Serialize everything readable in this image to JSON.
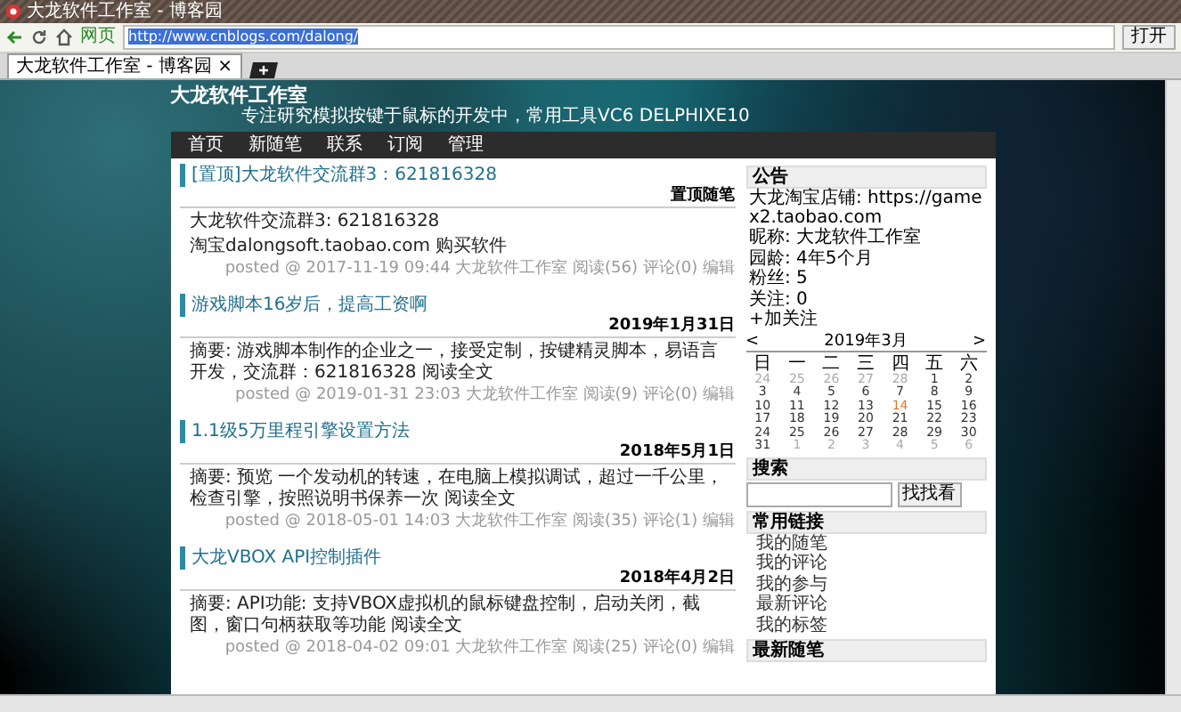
{
  "browser": {
    "window_title": "大龙软件工作室 - 博客园",
    "site_label": "网页",
    "address": "http://www.cnblogs.com/dalong/",
    "go_button": "打开",
    "tab": {
      "title": "大龙软件工作室 - 博客园",
      "close": "×"
    }
  },
  "blog": {
    "title": "大龙软件工作室",
    "subtitle": "专注研究模拟按键于鼠标的开发中，常用工具VC6 DELPHIXE10",
    "nav": [
      "首页",
      "新随笔",
      "联系",
      "订阅",
      "管理"
    ]
  },
  "posts": [
    {
      "title": "[置顶]大龙软件交流群3：621816328",
      "date": "置顶随笔",
      "body": [
        "大龙软件交流群3: 621816328",
        "淘宝dalongsoft.taobao.com 购买软件"
      ],
      "footer": "posted @ 2017-11-19 09:44 大龙软件工作室 阅读(56) 评论(0) 编辑"
    },
    {
      "title": "游戏脚本16岁后，提高工资啊",
      "date": "2019年1月31日",
      "body": [
        "摘要: 游戏脚本制作的企业之一，接受定制，按键精灵脚本，易语言开发，交流群：621816328 阅读全文"
      ],
      "footer": "posted @ 2019-01-31 23:03 大龙软件工作室 阅读(9) 评论(0) 编辑"
    },
    {
      "title": "1.1级5万里程引擎设置方法",
      "date": "2018年5月1日",
      "body": [
        "摘要: 预览 一个发动机的转速，在电脑上模拟调试，超过一千公里，检查引擎，按照说明书保养一次 阅读全文"
      ],
      "footer": "posted @ 2018-05-01 14:03 大龙软件工作室 阅读(35) 评论(1) 编辑"
    },
    {
      "title": "大龙VBOX API控制插件",
      "date": "2018年4月2日",
      "body": [
        "摘要: API功能: 支持VBOX虚拟机的鼠标键盘控制，启动关闭，截图，窗口句柄获取等功能 阅读全文"
      ],
      "footer": "posted @ 2018-04-02 09:01 大龙软件工作室 阅读(25) 评论(0) 编辑"
    }
  ],
  "sidebar": {
    "notice": {
      "heading": "公告",
      "lines": [
        "大龙淘宝店铺: https://gamex2.taobao.com",
        "昵称: 大龙软件工作室",
        "园龄: 4年5个月",
        "粉丝: 5",
        "关注: 0"
      ],
      "follow": "+加关注"
    },
    "calendar": {
      "month": "2019年3月",
      "prev": "<",
      "next": ">",
      "weekdays": [
        "日",
        "一",
        "二",
        "三",
        "四",
        "五",
        "六"
      ],
      "weeks": [
        [
          {
            "day": "24",
            "other": true,
            "today": false
          },
          {
            "day": "25",
            "other": true,
            "today": false
          },
          {
            "day": "26",
            "other": true,
            "today": false
          },
          {
            "day": "27",
            "other": true,
            "today": false
          },
          {
            "day": "28",
            "other": true,
            "today": false
          },
          {
            "day": "1",
            "other": false,
            "today": false
          },
          {
            "day": "2",
            "other": false,
            "today": false
          }
        ],
        [
          {
            "day": "3",
            "other": false,
            "today": false
          },
          {
            "day": "4",
            "other": false,
            "today": false
          },
          {
            "day": "5",
            "other": false,
            "today": false
          },
          {
            "day": "6",
            "other": false,
            "today": false
          },
          {
            "day": "7",
            "other": false,
            "today": false
          },
          {
            "day": "8",
            "other": false,
            "today": false
          },
          {
            "day": "9",
            "other": false,
            "today": false
          }
        ],
        [
          {
            "day": "10",
            "other": false,
            "today": false
          },
          {
            "day": "11",
            "other": false,
            "today": false
          },
          {
            "day": "12",
            "other": false,
            "today": false
          },
          {
            "day": "13",
            "other": false,
            "today": false
          },
          {
            "day": "14",
            "other": false,
            "today": true
          },
          {
            "day": "15",
            "other": false,
            "today": false
          },
          {
            "day": "16",
            "other": false,
            "today": false
          }
        ],
        [
          {
            "day": "17",
            "other": false,
            "today": false
          },
          {
            "day": "18",
            "other": false,
            "today": false
          },
          {
            "day": "19",
            "other": false,
            "today": false
          },
          {
            "day": "20",
            "other": false,
            "today": false
          },
          {
            "day": "21",
            "other": false,
            "today": false
          },
          {
            "day": "22",
            "other": false,
            "today": false
          },
          {
            "day": "23",
            "other": false,
            "today": false
          }
        ],
        [
          {
            "day": "24",
            "other": false,
            "today": false
          },
          {
            "day": "25",
            "other": false,
            "today": false
          },
          {
            "day": "26",
            "other": false,
            "today": false
          },
          {
            "day": "27",
            "other": false,
            "today": false
          },
          {
            "day": "28",
            "other": false,
            "today": false
          },
          {
            "day": "29",
            "other": false,
            "today": false
          },
          {
            "day": "30",
            "other": false,
            "today": false
          }
        ],
        [
          {
            "day": "31",
            "other": false,
            "today": false
          },
          {
            "day": "1",
            "other": true,
            "today": false
          },
          {
            "day": "2",
            "other": true,
            "today": false
          },
          {
            "day": "3",
            "other": true,
            "today": false
          },
          {
            "day": "4",
            "other": true,
            "today": false
          },
          {
            "day": "5",
            "other": true,
            "today": false
          },
          {
            "day": "6",
            "other": true,
            "today": false
          }
        ]
      ]
    },
    "search": {
      "heading": "搜索",
      "button": "找找看"
    },
    "links": {
      "heading": "常用链接",
      "items": [
        "我的随笔",
        "我的评论",
        "我的参与",
        "最新评论",
        "我的标签"
      ]
    },
    "recent": {
      "heading": "最新随笔"
    }
  }
}
